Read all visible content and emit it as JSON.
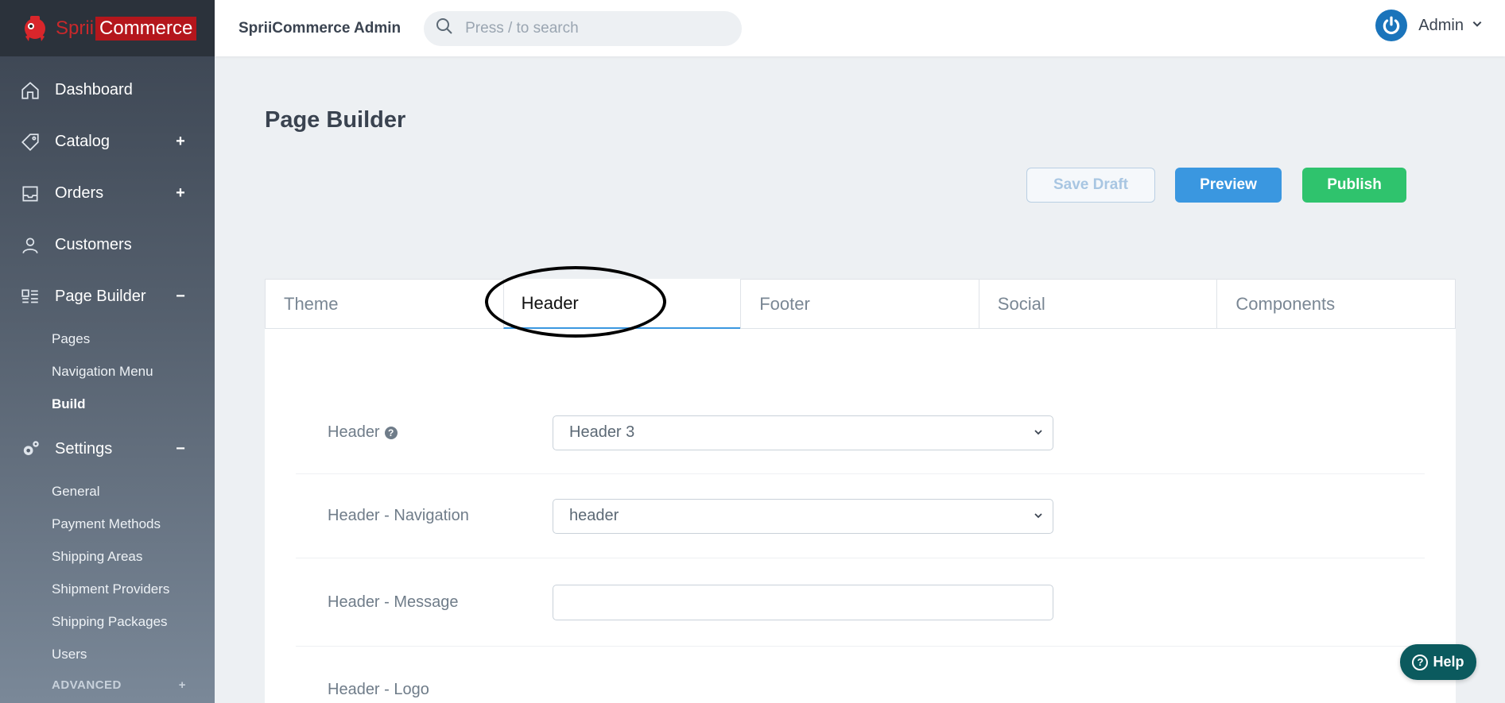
{
  "brand": {
    "part1": "Sprii",
    "part2": "Commerce"
  },
  "topbar": {
    "app_title": "SpriiCommerce Admin",
    "search_placeholder": "Press / to search",
    "user_name": "Admin"
  },
  "sidebar": {
    "items": [
      {
        "label": "Dashboard",
        "icon": "home-icon",
        "toggle": ""
      },
      {
        "label": "Catalog",
        "icon": "tag-icon",
        "toggle": "+"
      },
      {
        "label": "Orders",
        "icon": "inbox-icon",
        "toggle": "+"
      },
      {
        "label": "Customers",
        "icon": "user-icon",
        "toggle": ""
      },
      {
        "label": "Page Builder",
        "icon": "page-builder-icon",
        "toggle": "−"
      },
      {
        "label": "Settings",
        "icon": "gears-icon",
        "toggle": "−"
      }
    ],
    "page_builder_sub": [
      "Pages",
      "Navigation Menu",
      "Build"
    ],
    "active_sub": "Build",
    "settings_sub": [
      "General",
      "Payment Methods",
      "Shipping Areas",
      "Shipment Providers",
      "Shipping Packages",
      "Users"
    ],
    "advanced": {
      "label": "ADVANCED",
      "toggle": "+"
    }
  },
  "main": {
    "title": "Page Builder",
    "buttons": {
      "save_draft": "Save Draft",
      "preview": "Preview",
      "publish": "Publish"
    },
    "tabs": [
      "Theme",
      "Header",
      "Footer",
      "Social",
      "Components"
    ],
    "active_tab": "Header",
    "form": {
      "header_label": "Header",
      "header_value": "Header 3",
      "navigation_label": "Header - Navigation",
      "navigation_value": "header",
      "message_label": "Header - Message",
      "message_value": "",
      "logo_label": "Header - Logo"
    }
  },
  "help_label": "Help",
  "colors": {
    "accent": "#3a97e0",
    "success": "#2fc36d",
    "brand_red": "#b4161c",
    "help_bg": "#0b5a5e"
  }
}
